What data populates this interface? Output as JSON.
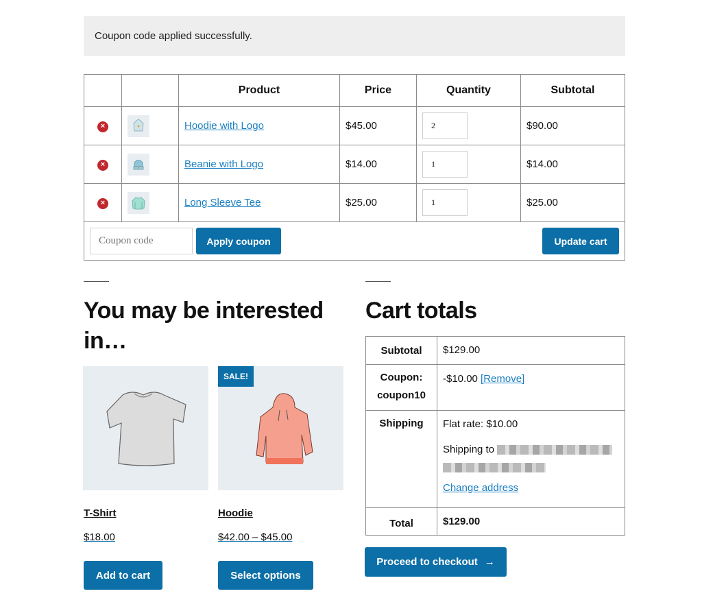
{
  "notice": {
    "message": "Coupon code applied successfully."
  },
  "cart_table": {
    "headers": [
      "",
      "",
      "Product",
      "Price",
      "Quantity",
      "Subtotal"
    ],
    "rows": [
      {
        "product": "Hoodie with Logo",
        "price": "$45.00",
        "quantity": "2",
        "subtotal": "$90.00",
        "thumb": "hoodie-thumbnail"
      },
      {
        "product": "Beanie with Logo",
        "price": "$14.00",
        "quantity": "1",
        "subtotal": "$14.00",
        "thumb": "beanie-thumbnail"
      },
      {
        "product": "Long Sleeve Tee",
        "price": "$25.00",
        "quantity": "1",
        "subtotal": "$25.00",
        "thumb": "long-sleeve-tee-thumbnail"
      }
    ],
    "remove_icon": "×",
    "coupon_placeholder": "Coupon code",
    "apply_coupon_label": "Apply coupon",
    "update_cart_label": "Update cart"
  },
  "cross_sells": {
    "heading": "You may be interested in…",
    "products": [
      {
        "name": "T-Shirt",
        "price": "$18.00",
        "button": "Add to cart",
        "sale": false
      },
      {
        "name": "Hoodie",
        "price": "$42.00 – $45.00",
        "button": "Select options",
        "sale": true,
        "sale_label": "SALE!"
      }
    ]
  },
  "cart_totals": {
    "heading": "Cart totals",
    "subtotal_label": "Subtotal",
    "subtotal_value": "$129.00",
    "coupon_label": "Coupon: coupon10",
    "coupon_value": "-$10.00",
    "coupon_remove": "[Remove]",
    "shipping_label": "Shipping",
    "shipping_method": "Flat rate: $10.00",
    "shipping_to": "Shipping to",
    "change_address": "Change address",
    "total_label": "Total",
    "total_value": "$129.00",
    "checkout_label": "Proceed to checkout",
    "checkout_arrow": "→"
  },
  "colors": {
    "accent": "#0d6fa7",
    "link": "#1a7fc1",
    "remove": "#c0282d",
    "notice_bg": "#eeeeee",
    "image_bg": "#e8edf2"
  }
}
